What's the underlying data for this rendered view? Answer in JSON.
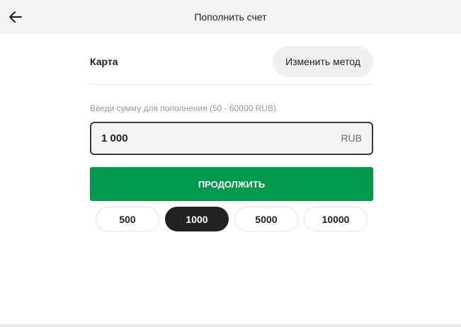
{
  "header": {
    "title": "Пополнить счет",
    "back_icon": "arrow-left-icon"
  },
  "method": {
    "label": "Карта",
    "change_label": "Изменить метод"
  },
  "amount": {
    "hint": "Введи сумму для пополнения (50 - 60000 RUB)",
    "value": "1 000",
    "currency": "RUB"
  },
  "continue_label": "ПРОДОЛЖИТЬ",
  "presets": [
    {
      "label": "500",
      "selected": false
    },
    {
      "label": "1000",
      "selected": true
    },
    {
      "label": "5000",
      "selected": false
    },
    {
      "label": "10000",
      "selected": false
    }
  ],
  "colors": {
    "accent": "#03994d",
    "selected_chip": "#222222",
    "header_bg": "#f3f3f3"
  }
}
